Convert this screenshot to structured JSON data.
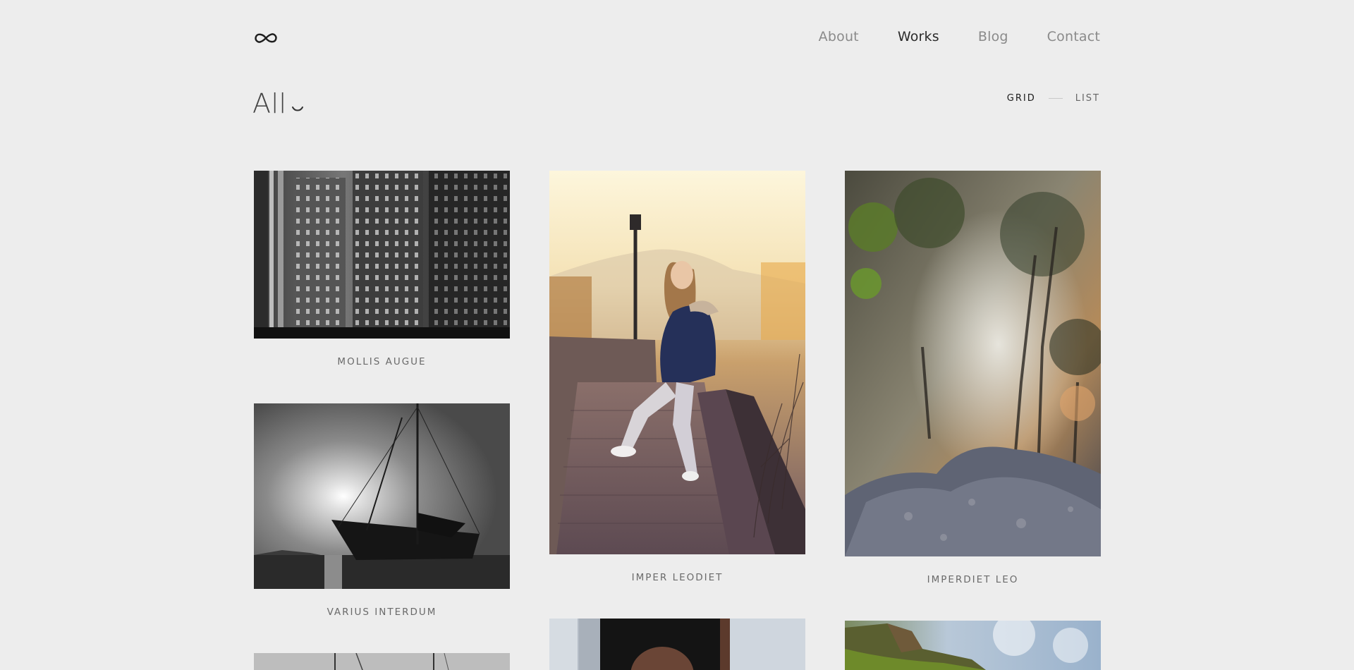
{
  "header": {
    "logo_icon": "infinity-icon",
    "nav": [
      {
        "label": "About",
        "active": false
      },
      {
        "label": "Works",
        "active": true
      },
      {
        "label": "Blog",
        "active": false
      },
      {
        "label": "Contact",
        "active": false
      }
    ]
  },
  "filter": {
    "label": "All",
    "icon": "chevron-down-icon"
  },
  "view_toggle": {
    "grid_label": "GRID",
    "list_label": "LIST",
    "active": "grid"
  },
  "works": [
    {
      "caption": "MOLLIS AUGUE"
    },
    {
      "caption": "VARIUS INTERDUM"
    },
    {
      "caption": "IMPER LEODIET"
    },
    {
      "caption": "IMPERDIET LEO"
    },
    {
      "caption": ""
    },
    {
      "caption": ""
    },
    {
      "caption": ""
    }
  ],
  "colors": {
    "background": "#ededed",
    "nav_active": "#2a2a2a",
    "nav_inactive": "#8a8a8a",
    "caption": "#6a6a6a"
  }
}
